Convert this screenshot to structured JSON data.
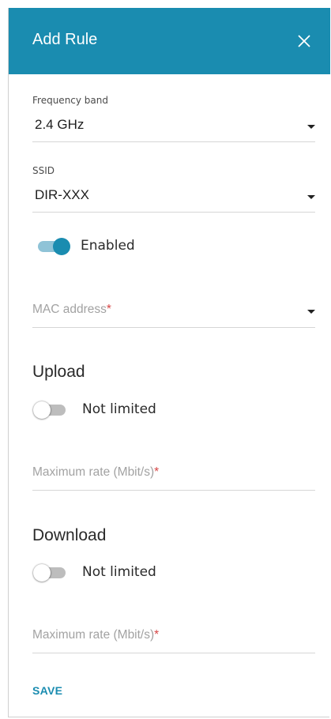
{
  "dialog": {
    "title": "Add Rule",
    "header_color": "#1a8cb0"
  },
  "frequency_band": {
    "label": "Frequency band",
    "value": "2.4 GHz"
  },
  "ssid": {
    "label": "SSID",
    "value": "DIR-XXX"
  },
  "enabled_toggle": {
    "label": "Enabled",
    "on": true
  },
  "mac_address": {
    "placeholder": "MAC address",
    "required_mark": "*"
  },
  "upload": {
    "title": "Upload",
    "toggle_label": "Not limited",
    "toggle_on": false,
    "rate_placeholder": "Maximum rate (Mbit/s)",
    "required_mark": "*"
  },
  "download": {
    "title": "Download",
    "toggle_label": "Not limited",
    "toggle_on": false,
    "rate_placeholder": "Maximum rate (Mbit/s)",
    "required_mark": "*"
  },
  "actions": {
    "save_label": "SAVE"
  },
  "icons": {
    "close": "close-icon",
    "dropdown": "caret-down-icon"
  }
}
